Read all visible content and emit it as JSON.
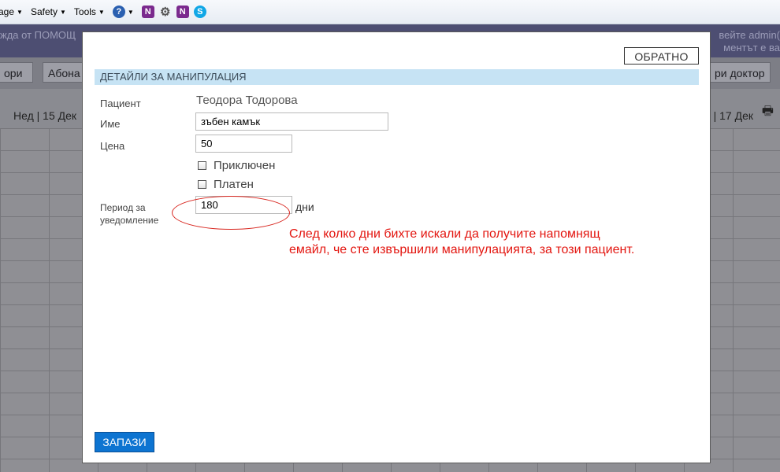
{
  "toolbar": {
    "items": [
      {
        "label": "Page"
      },
      {
        "label": "Safety"
      },
      {
        "label": "Tools"
      }
    ],
    "icons": [
      "help-icon",
      "onenote-icon",
      "gear-icon",
      "onenote-icon",
      "skype-icon"
    ]
  },
  "background": {
    "band_left": "жда от ПОМОЩ",
    "band_right1": "вейте admin(",
    "band_right2": "ментът е ва",
    "nav_buttons": [
      "ори",
      "Абона",
      "ри доктор"
    ],
    "date_left": "Нед | 15 Дек",
    "date_right": "| 17 Дек"
  },
  "modal": {
    "back_label": "ОБРАТНО",
    "section_title": "ДЕТАЙЛИ ЗА МАНИПУЛАЦИЯ",
    "patient_label": "Пациент",
    "patient_value": "Теодора Тодорова",
    "name_label": "Име",
    "name_value": "зъбен камък",
    "price_label": "Цена",
    "price_value": "50",
    "completed_label": "Приключен",
    "completed_checked": false,
    "paid_label": "Платен",
    "paid_checked": false,
    "period_label_1": "Период за",
    "period_label_2": "уведомление",
    "period_value": "180",
    "period_unit": "дни",
    "annotation_line1": "След колко дни бихте искали да получите напомнящ",
    "annotation_line2": "емайл, че сте извършили манипулацията, за този пациент.",
    "save_label": "ЗАПАЗИ"
  },
  "colors": {
    "section_header_bg": "#c6e3f4",
    "save_button_bg": "#0d74d1",
    "annotation_red": "#e3150f"
  }
}
